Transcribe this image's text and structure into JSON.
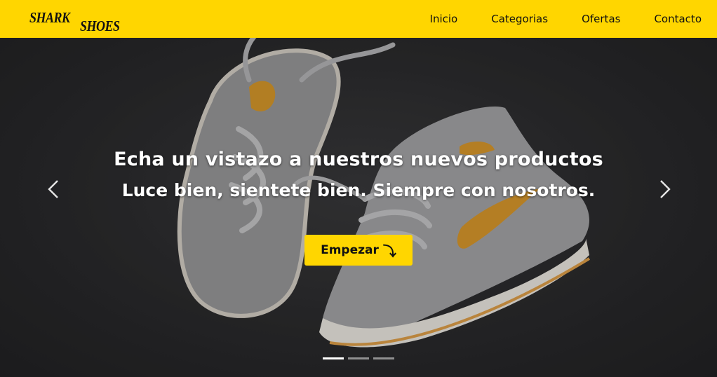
{
  "brand": {
    "word1": "SHARK",
    "word2": "SHOES"
  },
  "nav": {
    "items": [
      {
        "label": "Inicio"
      },
      {
        "label": "Categorias"
      },
      {
        "label": "Ofertas"
      },
      {
        "label": "Contacto"
      }
    ]
  },
  "hero": {
    "headline": "Echa un vistazo a nuestros nuevos productos",
    "subheadline": "Luce bien, sientete bien. Siempre con nosotros.",
    "cta_label": "Empezar",
    "cta_arrow": "⤵",
    "slides_total": 3,
    "active_slide": 1
  },
  "colors": {
    "accent": "#ffd600",
    "background": "#2b2b2d",
    "text_light": "#ffffff"
  },
  "icons": {
    "prev": "chevron-left-icon",
    "next": "chevron-right-icon"
  }
}
